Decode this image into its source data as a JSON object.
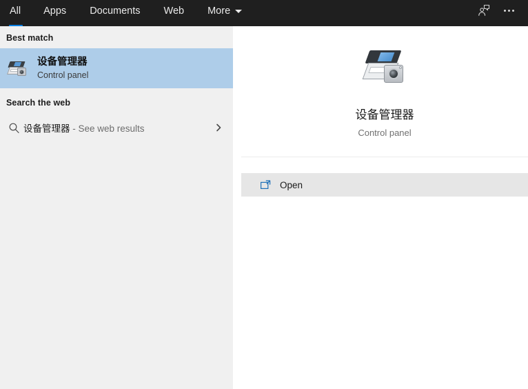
{
  "topbar": {
    "tabs": [
      {
        "label": "All",
        "active": true
      },
      {
        "label": "Apps",
        "active": false
      },
      {
        "label": "Documents",
        "active": false
      },
      {
        "label": "Web",
        "active": false
      },
      {
        "label": "More",
        "active": false
      }
    ],
    "feedback_icon": "person-feedback-icon",
    "overflow_icon": "more-options-icon",
    "accent_color": "#0a80e4",
    "background_color": "#1f1f1f"
  },
  "left_panel": {
    "best_match": {
      "header": "Best match",
      "item": {
        "title": "设备管理器",
        "subtitle": "Control panel",
        "icon": "device-manager-icon",
        "selected": true,
        "highlight_color": "#aecde9"
      }
    },
    "search_web": {
      "header": "Search the web",
      "item": {
        "query": "设备管理器",
        "suffix": " - See web results",
        "icon": "search-icon",
        "chevron": "chevron-right-icon"
      }
    },
    "background_color": "#f0f0f0"
  },
  "right_panel": {
    "preview": {
      "icon": "device-manager-icon",
      "title": "设备管理器",
      "subtitle": "Control panel"
    },
    "actions": [
      {
        "label": "Open",
        "icon": "open-in-window-icon",
        "hovered": true,
        "background_color": "#e6e6e6"
      }
    ],
    "background_color": "#ffffff"
  }
}
